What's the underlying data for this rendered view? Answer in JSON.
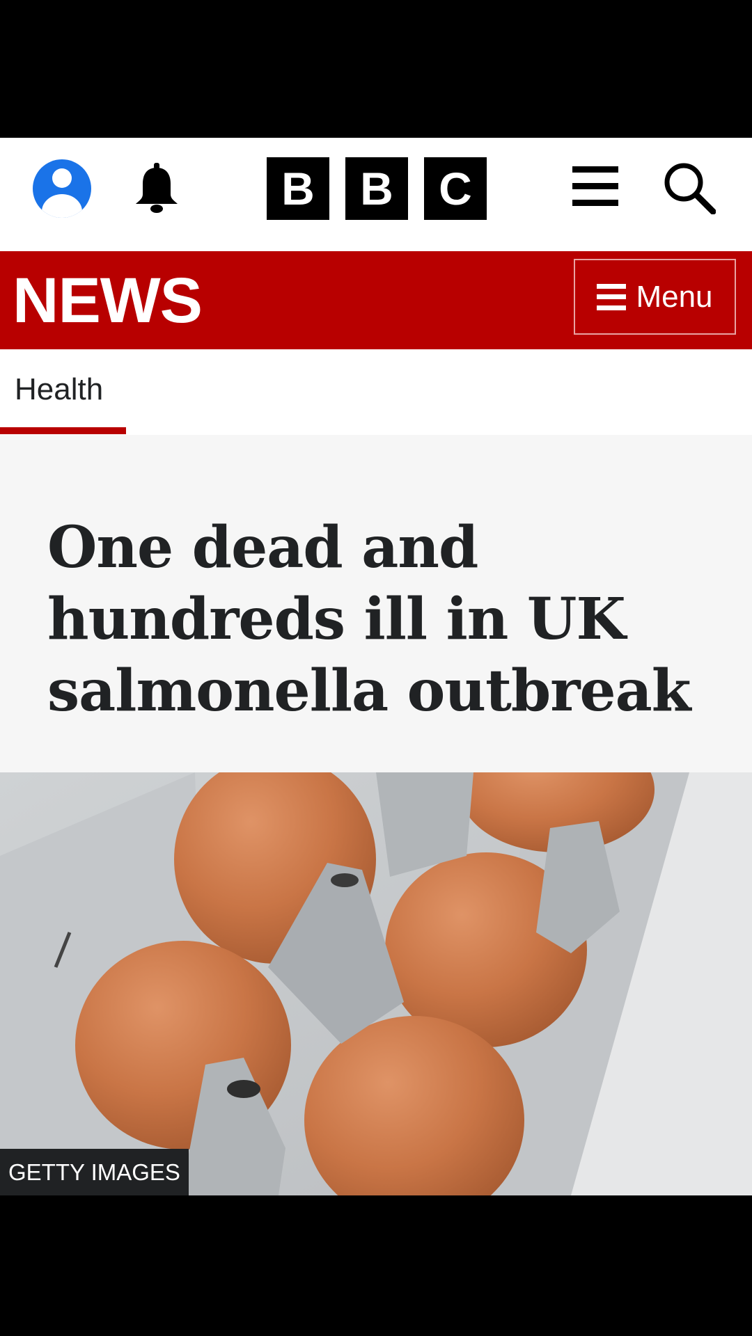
{
  "masthead": {
    "logo_letters": [
      "B",
      "B",
      "C"
    ],
    "icons": {
      "account": "user-account-icon",
      "notifications": "bell-icon",
      "more": "hamburger-menu-icon",
      "search": "search-icon"
    }
  },
  "newsbar": {
    "title": "NEWS",
    "menu_label": "Menu",
    "background_color": "#b80000"
  },
  "section_nav": {
    "active_item": "Health",
    "accent_color": "#b80000"
  },
  "article": {
    "headline": "One dead and hundreds ill in UK salmonella outbreak",
    "image": {
      "subject": "brown eggs in a grey cardboard egg carton",
      "credit": "GETTY IMAGES"
    }
  },
  "colors": {
    "account_blue": "#1a73e8",
    "text_dark": "#202224",
    "headline_bg": "#f6f6f6"
  }
}
